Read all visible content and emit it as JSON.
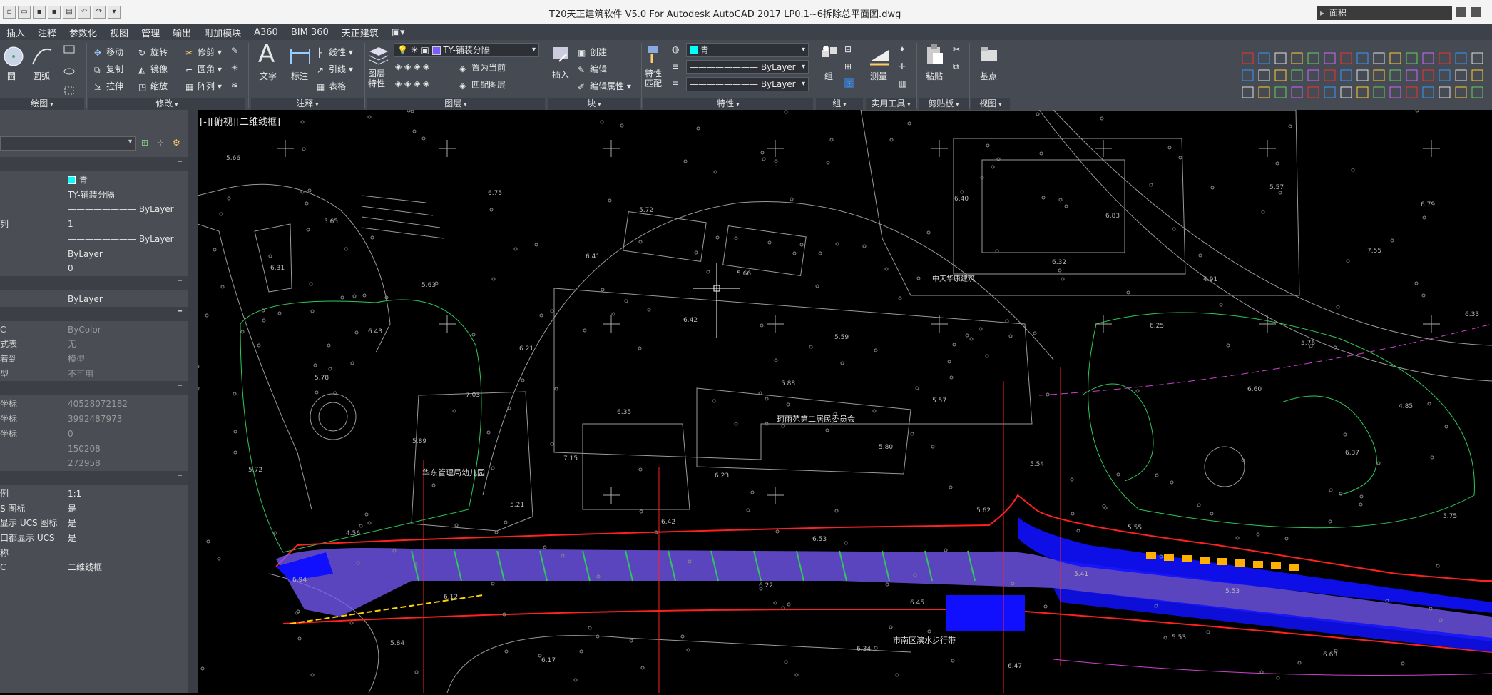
{
  "titlebar": {
    "title": "T20天正建筑软件 V5.0 For Autodesk AutoCAD 2017      LP0.1~6拆除总平面图.dwg",
    "search_placeholder": "面积"
  },
  "ribbon_tabs": [
    "插入",
    "注释",
    "参数化",
    "视图",
    "管理",
    "输出",
    "附加模块",
    "A360",
    "BIM 360",
    "天正建筑"
  ],
  "ribbon": {
    "draw": {
      "circle": "圆",
      "arc": "圆弧",
      "footer": "绘图"
    },
    "modify": {
      "move": "移动",
      "rotate": "旋转",
      "trim": "修剪",
      "copy": "复制",
      "mirror": "镜像",
      "fillet": "圆角",
      "stretch": "拉伸",
      "scale": "缩放",
      "array": "阵列",
      "footer": "修改"
    },
    "annotation": {
      "text": "文字",
      "dimension": "标注",
      "linear": "线性",
      "leader": "引线",
      "table": "表格",
      "footer": "注释"
    },
    "layers": {
      "layer_props": "图层\n特性",
      "current_layer": "TY-铺装分隔",
      "set_current": "置为当前",
      "match_layer": "匹配图层",
      "footer": "图层"
    },
    "block": {
      "insert": "插入",
      "create": "创建",
      "edit": "编辑",
      "edit_attr": "编辑属性",
      "footer": "块"
    },
    "properties": {
      "match": "特性\n匹配",
      "color": "青",
      "linetype": "ByLayer",
      "lineweight": "ByLayer",
      "footer": "特性"
    },
    "groups": {
      "group": "组",
      "footer": "组"
    },
    "utilities": {
      "measure": "测量",
      "footer": "实用工具"
    },
    "clipboard": {
      "paste": "粘贴",
      "footer": "剪贴板"
    },
    "view": {
      "base": "基点",
      "footer": "视图"
    }
  },
  "properties_panel": {
    "general": [
      {
        "k": "",
        "v": "青",
        "swatch": "#00ffff"
      },
      {
        "k": "",
        "v": "TY-铺装分隔"
      },
      {
        "k": "",
        "v": "———————— ByLayer"
      },
      {
        "k": "列",
        "v": "1"
      },
      {
        "k": "",
        "v": "———————— ByLayer"
      },
      {
        "k": "",
        "v": "ByLayer"
      },
      {
        "k": "",
        "v": "0"
      }
    ],
    "plot": [
      {
        "k": "",
        "v": "ByLayer"
      }
    ],
    "misc": [
      {
        "k": "C",
        "v": "ByColor"
      },
      {
        "k": "式表",
        "v": "无"
      },
      {
        "k": "着到",
        "v": "模型"
      },
      {
        "k": "型",
        "v": "不可用"
      }
    ],
    "view": [
      {
        "k": "坐标",
        "v": "40528072182"
      },
      {
        "k": "坐标",
        "v": "3992487973"
      },
      {
        "k": "坐标",
        "v": "0"
      },
      {
        "k": "",
        "v": "150208"
      },
      {
        "k": "",
        "v": "272958"
      }
    ],
    "other": [
      {
        "k": "例",
        "v": "1:1"
      },
      {
        "k": "S 图标",
        "v": "是"
      },
      {
        "k": "显示 UCS 图标",
        "v": "是"
      },
      {
        "k": "口都显示 UCS",
        "v": "是"
      },
      {
        "k": "称",
        "v": ""
      },
      {
        "k": "C",
        "v": "二维线框"
      }
    ]
  },
  "viewport": {
    "label": "[-][俯视][二维线框]",
    "map_labels": {
      "kindergarten": "华东管理局幼儿园",
      "committee": "珂雨苑第二居民委员会",
      "bottom": "市南区滨水步行带",
      "top_right": "中天华康建筑"
    },
    "elevations": [
      "5.66",
      "5.65",
      "5.63",
      "6.21",
      "6.35",
      "6.23",
      "6.53",
      "6.45",
      "6.47",
      "6.83",
      "4.91",
      "5.76",
      "4.85",
      "5.72",
      "4.56",
      "6.12",
      "6.17",
      "5.72",
      "5.66",
      "5.59",
      "5.57",
      "5.54",
      "5.55",
      "5.53",
      "6.68",
      "6.79",
      "6.31",
      "6.43",
      "7.03",
      "7.15",
      "6.42",
      "6.22",
      "6.34",
      "6.40",
      "6.32",
      "6.25",
      "6.60",
      "6.37",
      "5.75",
      "6.94",
      "5.84",
      "6.75",
      "6.41",
      "6.42",
      "5.88",
      "5.80",
      "5.62",
      "5.41",
      "5.53",
      "5.57",
      "7.55",
      "6.33",
      "5.78",
      "5.89",
      "5.21"
    ]
  },
  "colors": {
    "accent_cyan": "#00ffff",
    "road_purple": "#7a5cff",
    "road_blue": "#1010ff",
    "boundary_red": "#ff2020",
    "green_lines": "#2ec85a"
  }
}
